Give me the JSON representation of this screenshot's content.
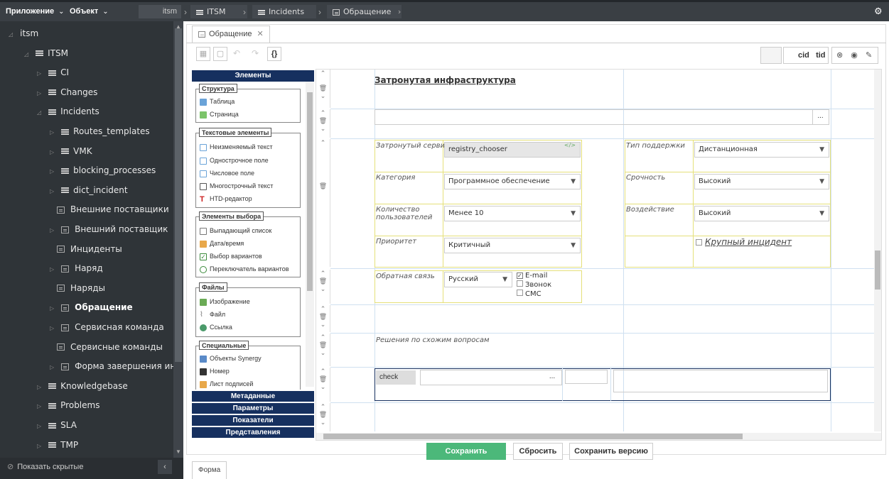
{
  "topbar": {
    "app_menu": "Приложение",
    "object_menu": "Объект",
    "crumb_root": "itsm",
    "crumb_itsm": "ITSM",
    "crumb_incidents": "Incidents",
    "crumb_request": "Обращение"
  },
  "sidebar": {
    "items": [
      {
        "label": "itsm"
      },
      {
        "label": "ITSM"
      },
      {
        "label": "CI"
      },
      {
        "label": "Changes"
      },
      {
        "label": "Incidents"
      },
      {
        "label": "Routes_templates"
      },
      {
        "label": "VMK"
      },
      {
        "label": "blocking_processes"
      },
      {
        "label": "dict_incident"
      },
      {
        "label": "Внешние поставщики"
      },
      {
        "label": "Внешний поставщик"
      },
      {
        "label": "Инциденты"
      },
      {
        "label": "Наряд"
      },
      {
        "label": "Наряды"
      },
      {
        "label": "Обращение"
      },
      {
        "label": "Сервисная команда"
      },
      {
        "label": "Сервисные команды"
      },
      {
        "label": "Форма завершения инцидента"
      },
      {
        "label": "Knowledgebase"
      },
      {
        "label": "Problems"
      },
      {
        "label": "SLA"
      },
      {
        "label": "TMP"
      }
    ],
    "show_hidden": "Показать скрытые"
  },
  "tabs": {
    "form_tab": "Обращение",
    "bottom_tab": "Форма"
  },
  "toolbar": {
    "json_label": "{}",
    "cid": "cid",
    "tid": "tid"
  },
  "palette": {
    "elements_header": "Элементы",
    "groups": {
      "structure": {
        "title": "Структура",
        "items": [
          "Таблица",
          "Страница"
        ]
      },
      "text": {
        "title": "Текстовые элементы",
        "items": [
          "Неизменяемый текст",
          "Однострочное поле",
          "Числовое поле",
          "Многострочный текст",
          "HTD-редактор"
        ]
      },
      "choice": {
        "title": "Элементы выбора",
        "items": [
          "Выпадающий список",
          "Дата/время",
          "Выбор вариантов",
          "Переключатель вариантов"
        ]
      },
      "files": {
        "title": "Файлы",
        "items": [
          "Изображение",
          "Файл",
          "Ссылка"
        ]
      },
      "special": {
        "title": "Специальные",
        "items": [
          "Объекты Synergy",
          "Номер",
          "Лист подписей"
        ]
      }
    },
    "sections": [
      "Метаданные",
      "Параметры",
      "Показатели",
      "Представления"
    ]
  },
  "form": {
    "heading": "Затронутая инфраструктура",
    "ellipsis": "...",
    "affected_service_label": "Затронутый сервис",
    "affected_service_value": "registry_chooser",
    "category_label": "Категория",
    "category_value": "Программное обеспечение",
    "users_count_label": "Количество пользователей",
    "users_count_value": "Менее 10",
    "priority_label": "Приоритет",
    "priority_value": "Критичный",
    "support_type_label": "Тип поддержки",
    "support_type_value": "Дистанционная",
    "urgency_label": "Срочность",
    "urgency_value": "Высокий",
    "impact_label": "Воздействие",
    "impact_value": "Высокий",
    "major_incident": "Крупный инцидент",
    "feedback_label": "Обратная связь",
    "feedback_lang": "Русский",
    "feedback_options": [
      "E-mail",
      "Звонок",
      "СМС"
    ],
    "similar_label": "Решения по схожим вопросам",
    "check_label": "check"
  },
  "actions": {
    "save": "Сохранить",
    "reset": "Сбросить",
    "save_version": "Сохранить версию"
  },
  "colors": {
    "accent_green": "#4cb87a",
    "palette_header": "#16305f",
    "sidebar_bg": "#2f3438"
  }
}
